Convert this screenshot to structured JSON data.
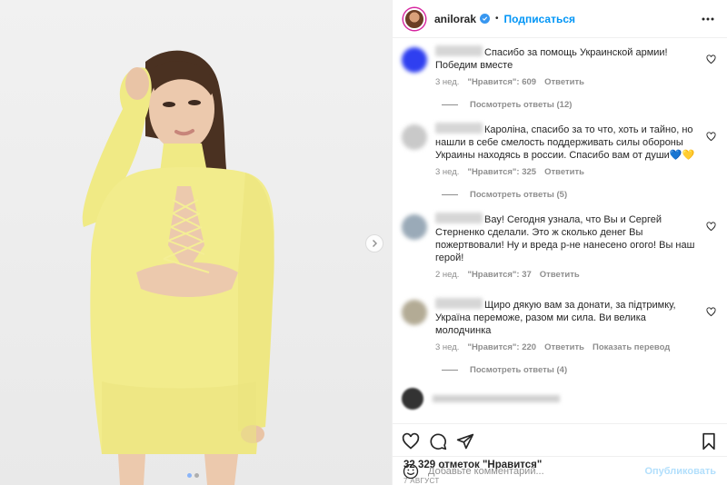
{
  "header": {
    "username": "anilorak",
    "separator": "•",
    "follow_label": "Подписаться"
  },
  "comments": [
    {
      "avatar_color": "#2f3ff0",
      "text": "Спасибо за помощь Украинской армии! Победим вместе",
      "time": "3 нед.",
      "likes": "\"Нравится\": 609",
      "reply": "Ответить",
      "translate": "",
      "replies": "Посмотреть ответы (12)"
    },
    {
      "avatar_color": "#c9c9c9",
      "text": "Каролiна, спасибо за то что, хоть и тайно, но нашли в себе смелость поддерживать силы обороны Украины находясь в россии. Спасибо вам от души💙💛",
      "time": "3 нед.",
      "likes": "\"Нравится\": 325",
      "reply": "Ответить",
      "translate": "",
      "replies": "Посмотреть ответы (5)"
    },
    {
      "avatar_color": "#9aaab8",
      "text": "Вау! Сегодня узнала, что Вы и Сергей Стерненко сделали. Это ж сколько денег Вы пожертвовали! Ну и вреда р-не нанесено огого! Вы наш герой!",
      "time": "2 нед.",
      "likes": "\"Нравится\": 37",
      "reply": "Ответить",
      "translate": "",
      "replies": ""
    },
    {
      "avatar_color": "#b3ab95",
      "text": "Щиро дякую вам за донати, за підтримку, Україна переможе, разом ми сила. Ви велика молодчинка",
      "time": "3 нед.",
      "likes": "\"Нравится\": 220",
      "reply": "Ответить",
      "translate": "Показать перевод",
      "replies": "Посмотреть ответы (4)"
    }
  ],
  "likes_count": "32 329 отметок \"Нравится\"",
  "date": "7 август",
  "add_comment": {
    "placeholder": "Добавьте комментарий...",
    "publish_label": "Опубликовать"
  },
  "colors": {
    "accent": "#0095f6",
    "muted": "#8e8e8e",
    "dress": "#f2ec8c",
    "publish_disabled": "#b2dffc"
  },
  "carousel": {
    "total_slides": 2,
    "active_slide": 1
  }
}
